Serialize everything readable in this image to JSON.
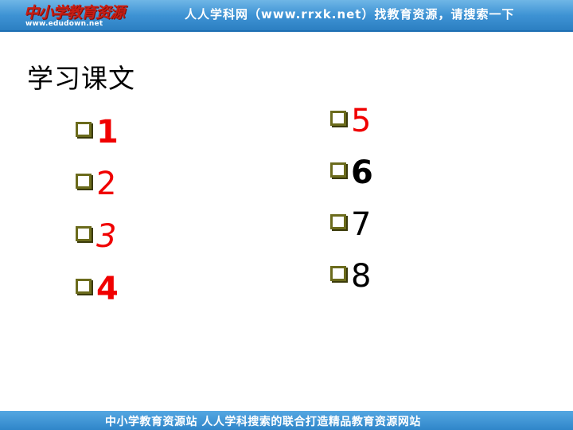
{
  "header": {
    "logo_text": "中小学教育资源",
    "logo_url": "www.edudown.net",
    "banner_text": "人人学科网（www.rrxk.net）找教育资源，请搜索一下"
  },
  "title": "学习课文",
  "items_left": [
    {
      "label": "1",
      "color": "#f00000",
      "style": "bold"
    },
    {
      "label": "2",
      "color": "#f00000",
      "style": "normal"
    },
    {
      "label": "3",
      "color": "#f00000",
      "style": "italic"
    },
    {
      "label": "4",
      "color": "#f00000",
      "style": "bold"
    }
  ],
  "items_right": [
    {
      "label": "5",
      "color": "#f00000",
      "style": "normal"
    },
    {
      "label": "6",
      "color": "#000000",
      "style": "bold"
    },
    {
      "label": "7",
      "color": "#000000",
      "style": "normal"
    },
    {
      "label": "8",
      "color": "#000000",
      "style": "normal"
    }
  ],
  "footer": {
    "text": "中小学教育资源站 人人学科搜索的联合打造精品教育资源网站"
  },
  "colors": {
    "banner": "#3e93d4",
    "bullet_box": "#6b6b1c",
    "accent_red": "#f00000"
  }
}
